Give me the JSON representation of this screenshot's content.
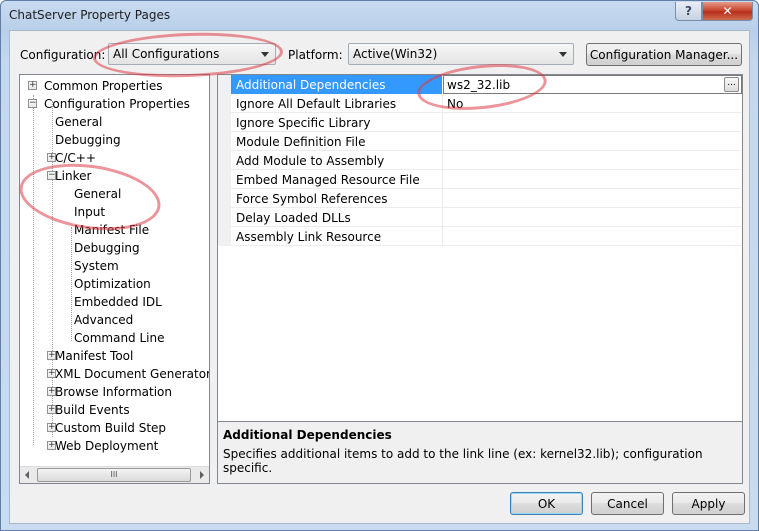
{
  "window": {
    "title": "ChatServer Property Pages",
    "help_label": "?",
    "close_label": "✕"
  },
  "config": {
    "configuration_label": "Configuration:",
    "configuration_value": "All Configurations",
    "platform_label": "Platform:",
    "platform_value": "Active(Win32)",
    "config_manager_label": "Configuration Manager..."
  },
  "tree": {
    "items": [
      {
        "label": "Common Properties",
        "expander": "+"
      },
      {
        "label": "Configuration Properties",
        "expander": "−"
      },
      {
        "label": "General"
      },
      {
        "label": "Debugging"
      },
      {
        "label": "C/C++",
        "expander": "+"
      },
      {
        "label": "Linker",
        "expander": "−"
      },
      {
        "label": "General"
      },
      {
        "label": "Input"
      },
      {
        "label": "Manifest File"
      },
      {
        "label": "Debugging"
      },
      {
        "label": "System"
      },
      {
        "label": "Optimization"
      },
      {
        "label": "Embedded IDL"
      },
      {
        "label": "Advanced"
      },
      {
        "label": "Command Line"
      },
      {
        "label": "Manifest Tool",
        "expander": "+"
      },
      {
        "label": "XML Document Generator",
        "expander": "+"
      },
      {
        "label": "Browse Information",
        "expander": "+"
      },
      {
        "label": "Build Events",
        "expander": "+"
      },
      {
        "label": "Custom Build Step",
        "expander": "+"
      },
      {
        "label": "Web Deployment",
        "expander": "+"
      }
    ],
    "scroll_thumb_grip": "III"
  },
  "grid": {
    "rows": [
      {
        "name": "Additional Dependencies",
        "value": "ws2_32.lib"
      },
      {
        "name": "Ignore All Default Libraries",
        "value": "No"
      },
      {
        "name": "Ignore Specific Library",
        "value": ""
      },
      {
        "name": "Module Definition File",
        "value": ""
      },
      {
        "name": "Add Module to Assembly",
        "value": ""
      },
      {
        "name": "Embed Managed Resource File",
        "value": ""
      },
      {
        "name": "Force Symbol References",
        "value": ""
      },
      {
        "name": "Delay Loaded DLLs",
        "value": ""
      },
      {
        "name": "Assembly Link Resource",
        "value": ""
      }
    ],
    "ellipsis_label": "..."
  },
  "description": {
    "title": "Additional Dependencies",
    "text": "Specifies additional items to add to the link line (ex: kernel32.lib); configuration specific."
  },
  "buttons": {
    "ok": "OK",
    "cancel": "Cancel",
    "apply": "Apply"
  }
}
